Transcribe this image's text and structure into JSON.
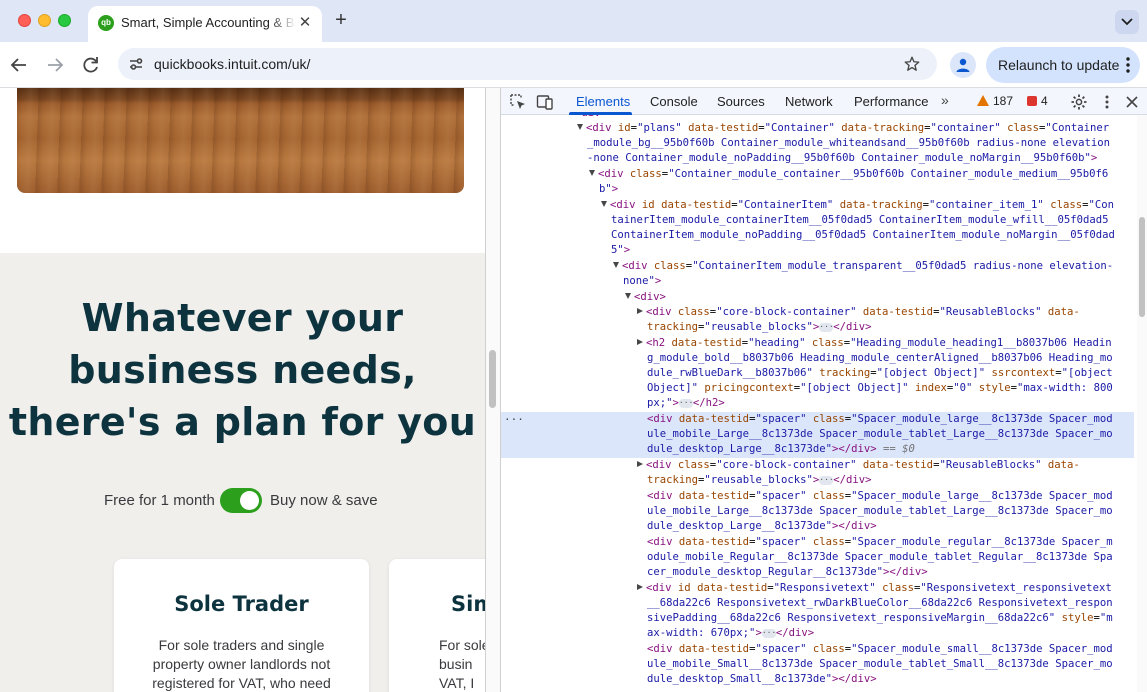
{
  "browser": {
    "tab_title": "Smart, Simple Accounting & Bookkeeping",
    "favicon_text": "qb",
    "url": "quickbooks.intuit.com/uk/",
    "relaunch_label": "Relaunch to update"
  },
  "page": {
    "heading_lines": [
      "Whatever your",
      "business needs,",
      "there's a plan for you"
    ],
    "toggle_left": "Free for 1 month",
    "toggle_right": "Buy now & save",
    "toggle_on": true,
    "cards": [
      {
        "title": "Sole Trader",
        "desc": "For sole traders and single property owner landlords not registered for VAT, who need"
      },
      {
        "title": "Sim",
        "desc": "For sole busin VAT, I"
      }
    ]
  },
  "devtools": {
    "tabs": [
      "Elements",
      "Console",
      "Sources",
      "Network",
      "Performance"
    ],
    "active_tab": "Elements",
    "warning_count": "187",
    "error_count": "4",
    "selected_suffix": "== $0"
  },
  "colors": {
    "brand_green": "#2ca01c",
    "heading_navy": "#0d333f",
    "devtools_accent": "#0b57d0"
  }
}
